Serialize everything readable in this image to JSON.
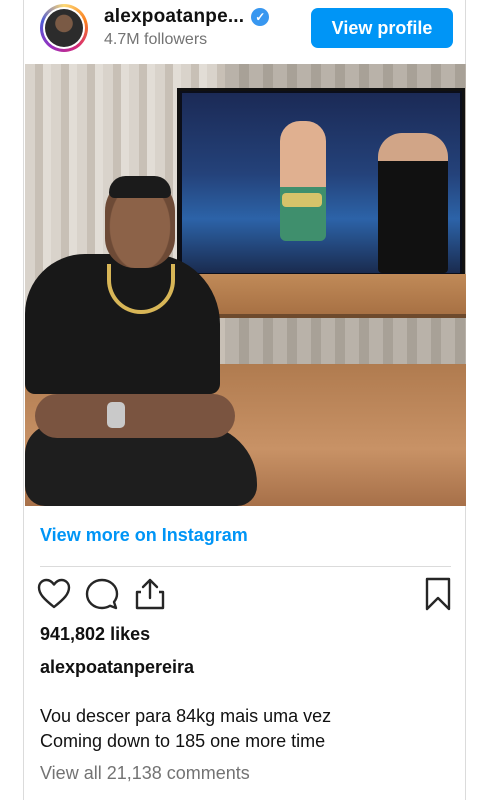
{
  "header": {
    "username": "alexpoatanpe...",
    "verified_glyph": "✓",
    "followers": "4.7M followers",
    "view_profile_label": "View profile"
  },
  "photo": {
    "alt": "Man sitting in front of a TV showing a fighter with a championship belt"
  },
  "links": {
    "view_more": "View more on Instagram"
  },
  "actions": {
    "like_icon": "heart-icon",
    "comment_icon": "comment-icon",
    "share_icon": "share-icon",
    "save_icon": "bookmark-icon"
  },
  "post": {
    "likes": "941,802 likes",
    "caption_user": "alexpoatanpereira",
    "caption_line1": "Vou descer para 84kg mais uma vez",
    "caption_line2": "Coming down to 185 one more time",
    "comments": "View all 21,138 comments"
  },
  "colors": {
    "accent": "#0095f6",
    "muted": "#737373",
    "verified": "#3897f0"
  }
}
